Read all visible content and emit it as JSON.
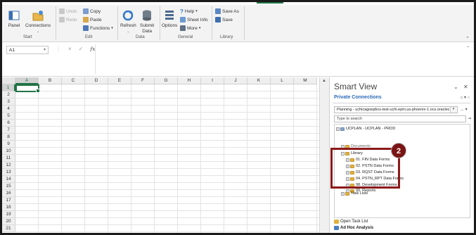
{
  "ribbon": {
    "buttons": {
      "panel": "Panel",
      "connections": "Connections",
      "undo": "Undo",
      "redo": "Redo",
      "copy": "Copy",
      "paste": "Paste",
      "functions": "Functions",
      "refresh": "Refresh",
      "submit_data": "Submit\nData",
      "options": "Options",
      "help": "Help",
      "sheet_info": "Sheet Info",
      "more": "More",
      "save_as": "Save As",
      "save": "Save"
    },
    "groups": {
      "start": "Start",
      "edit": "Edit",
      "data": "Data",
      "general": "General",
      "library": "Library"
    }
  },
  "formula_bar": {
    "name_box": "A1",
    "fx": "fx",
    "cancel": "×",
    "enter": "✓",
    "value": ""
  },
  "grid": {
    "columns": [
      "A",
      "B",
      "C",
      "D",
      "E",
      "F",
      "G",
      "H",
      "I",
      "J",
      "K",
      "L",
      "M"
    ],
    "rows": [
      "1",
      "2",
      "3",
      "4",
      "5",
      "6",
      "7",
      "8",
      "9",
      "10",
      "11",
      "12",
      "13",
      "14",
      "15",
      "16",
      "17",
      "18",
      "19",
      "20",
      "21"
    ],
    "active_cell": "A1"
  },
  "smart_view": {
    "title": "Smart View",
    "section": "Private Connections",
    "connection": "Planning - uchicagoepbcs-test-uchi.epm.us-phoenix-1.ocs.oraclec",
    "search_placeholder": "Type to search",
    "tree": [
      {
        "label": "UCPLAN - UCPLAN - PROD",
        "level": 0,
        "icon": "db"
      },
      {
        "label": "Documents",
        "level": 1,
        "icon": "fold",
        "dim": true
      },
      {
        "label": "Library",
        "level": 1,
        "icon": "fold"
      },
      {
        "label": "01. FIN Data Forms",
        "level": 2,
        "icon": "fold"
      },
      {
        "label": "02. PSTN Data Forms",
        "level": 2,
        "icon": "fold"
      },
      {
        "label": "03. RQST Data Forms",
        "level": 2,
        "icon": "fold"
      },
      {
        "label": "04. PSTN_RPT Data Forms",
        "level": 2,
        "icon": "fold"
      },
      {
        "label": "98. Development Forms",
        "level": 2,
        "icon": "fold"
      },
      {
        "label": "99. Reports",
        "level": 2,
        "icon": "fold"
      },
      {
        "label": "Task Lists",
        "level": 1,
        "icon": "fold"
      }
    ],
    "bottom_links": [
      "Open Task List",
      "Ad Hoc Analysis"
    ]
  },
  "callout": {
    "number": "2",
    "color": "#7a1414"
  }
}
